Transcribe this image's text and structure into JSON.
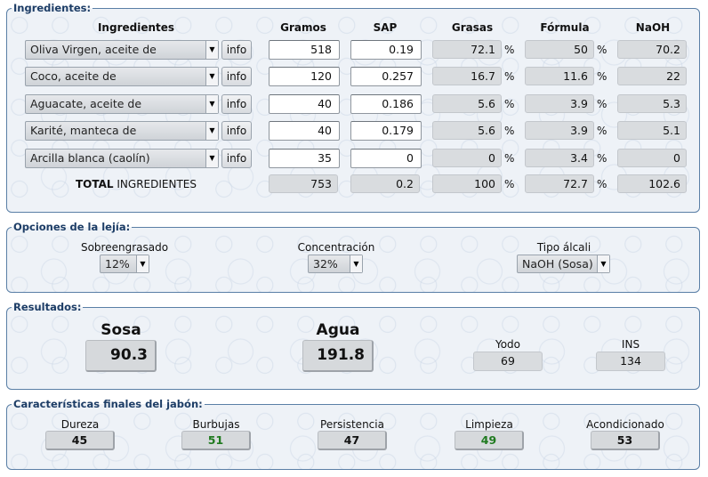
{
  "ingredientes": {
    "legend": "Ingredientes:",
    "headers": {
      "ingredientes": "Ingredientes",
      "gramos": "Gramos",
      "sap": "SAP",
      "grasas": "Grasas",
      "formula": "Fórmula",
      "naoh": "NaOH"
    },
    "pct_symbol": "%",
    "rows": [
      {
        "name": "Oliva Virgen, aceite de",
        "info": "info",
        "gramos": "518",
        "sap": "0.19",
        "grasas": "72.1",
        "formula": "50",
        "naoh": "70.2"
      },
      {
        "name": "Coco, aceite de",
        "info": "info",
        "gramos": "120",
        "sap": "0.257",
        "grasas": "16.7",
        "formula": "11.6",
        "naoh": "22"
      },
      {
        "name": "Aguacate, aceite de",
        "info": "info",
        "gramos": "40",
        "sap": "0.186",
        "grasas": "5.6",
        "formula": "3.9",
        "naoh": "5.3"
      },
      {
        "name": "Karité, manteca de",
        "info": "info",
        "gramos": "40",
        "sap": "0.179",
        "grasas": "5.6",
        "formula": "3.9",
        "naoh": "5.1"
      },
      {
        "name": "Arcilla blanca (caolín)",
        "info": "info",
        "gramos": "35",
        "sap": "0",
        "grasas": "0",
        "formula": "3.4",
        "naoh": "0"
      }
    ],
    "total": {
      "label_bold": "TOTAL",
      "label_rest": " INGREDIENTES",
      "gramos": "753",
      "sap": "0.2",
      "grasas": "100",
      "formula": "72.7",
      "naoh": "102.6"
    }
  },
  "lejia": {
    "legend": "Opciones de la lejía:",
    "sobreengrasado": {
      "label": "Sobreengrasado",
      "value": "12%"
    },
    "concentracion": {
      "label": "Concentración",
      "value": "32%"
    },
    "tipo_alcali": {
      "label": "Tipo álcali",
      "value": "NaOH (Sosa)"
    }
  },
  "resultados": {
    "legend": "Resultados:",
    "sosa": {
      "label": "Sosa",
      "value": "90.3"
    },
    "agua": {
      "label": "Agua",
      "value": "191.8"
    },
    "yodo": {
      "label": "Yodo",
      "value": "69"
    },
    "ins": {
      "label": "INS",
      "value": "134"
    }
  },
  "caracteristicas": {
    "legend": "Características finales del jabón:",
    "items": [
      {
        "label": "Dureza",
        "value": "45",
        "color": "#111111"
      },
      {
        "label": "Burbujas",
        "value": "51",
        "color": "#1f7a1f"
      },
      {
        "label": "Persistencia",
        "value": "47",
        "color": "#111111"
      },
      {
        "label": "Limpieza",
        "value": "49",
        "color": "#1f7a1f"
      },
      {
        "label": "Acondicionado",
        "value": "53",
        "color": "#111111"
      }
    ]
  },
  "icons": {
    "dropdown": "chevron-down-icon"
  }
}
